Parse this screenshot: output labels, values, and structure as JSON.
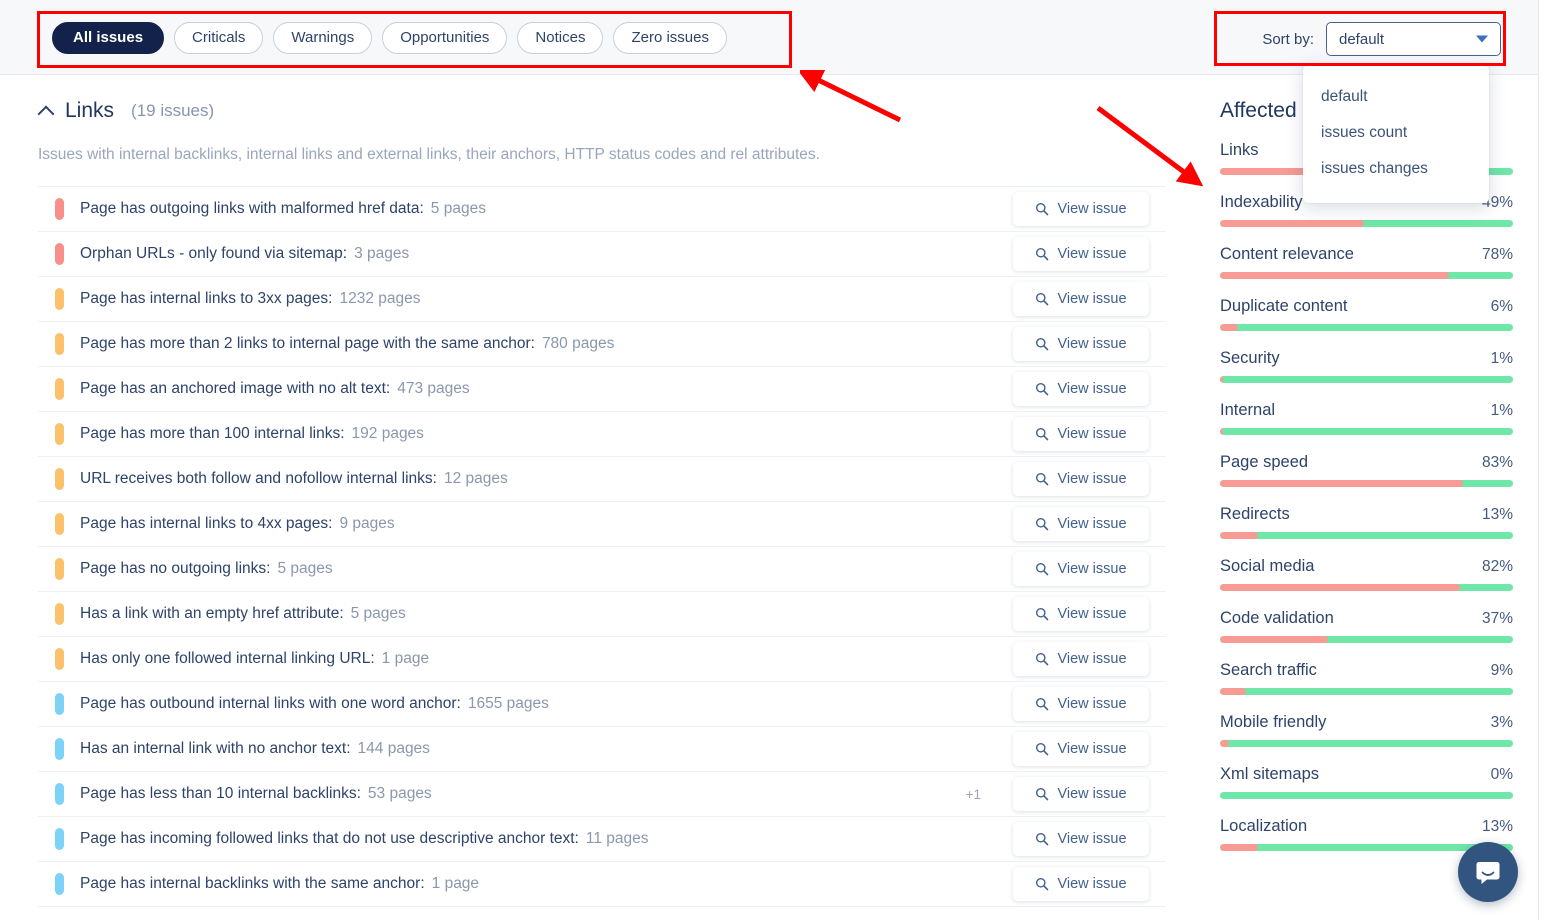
{
  "filters": {
    "tabs": [
      {
        "label": "All issues",
        "active": true
      },
      {
        "label": "Criticals",
        "active": false
      },
      {
        "label": "Warnings",
        "active": false
      },
      {
        "label": "Opportunities",
        "active": false
      },
      {
        "label": "Notices",
        "active": false
      },
      {
        "label": "Zero issues",
        "active": false
      }
    ]
  },
  "sort": {
    "label": "Sort by:",
    "selected": "default",
    "options": [
      "default",
      "issues count",
      "issues changes"
    ],
    "open": true
  },
  "section": {
    "title": "Links",
    "count": "(19 issues)",
    "description": "Issues with internal backlinks, internal links and external links, their anchors, HTTP status codes and rel attributes.",
    "view_issue_label": "View issue",
    "collapse_icon": "chevron-up-icon",
    "search_icon": "search-icon"
  },
  "issues": [
    {
      "severity": "critical",
      "title": "Page has outgoing links with malformed href data:",
      "count": "5 pages",
      "extra": ""
    },
    {
      "severity": "critical",
      "title": "Orphan URLs - only found via sitemap:",
      "count": "3 pages",
      "extra": ""
    },
    {
      "severity": "warning",
      "title": "Page has internal links to 3xx pages:",
      "count": "1232 pages",
      "extra": ""
    },
    {
      "severity": "warning",
      "title": "Page has more than 2 links to internal page with the same anchor:",
      "count": "780 pages",
      "extra": ""
    },
    {
      "severity": "warning",
      "title": "Page has an anchored image with no alt text:",
      "count": "473 pages",
      "extra": ""
    },
    {
      "severity": "warning",
      "title": "Page has more than 100 internal links:",
      "count": "192 pages",
      "extra": ""
    },
    {
      "severity": "warning",
      "title": "URL receives both follow and nofollow internal links:",
      "count": "12 pages",
      "extra": ""
    },
    {
      "severity": "warning",
      "title": "Page has internal links to 4xx pages:",
      "count": "9 pages",
      "extra": ""
    },
    {
      "severity": "warning",
      "title": "Page has no outgoing links:",
      "count": "5 pages",
      "extra": ""
    },
    {
      "severity": "warning",
      "title": "Has a link with an empty href attribute:",
      "count": "5 pages",
      "extra": ""
    },
    {
      "severity": "warning",
      "title": "Has only one followed internal linking URL:",
      "count": "1 page",
      "extra": ""
    },
    {
      "severity": "notice",
      "title": "Page has outbound internal links with one word anchor:",
      "count": "1655 pages",
      "extra": ""
    },
    {
      "severity": "notice",
      "title": "Has an internal link with no anchor text:",
      "count": "144 pages",
      "extra": ""
    },
    {
      "severity": "notice",
      "title": "Page has less than 10 internal backlinks:",
      "count": "53 pages",
      "extra": "+1"
    },
    {
      "severity": "notice",
      "title": "Page has incoming followed links that do not use descriptive anchor text:",
      "count": "11 pages",
      "extra": ""
    },
    {
      "severity": "notice",
      "title": "Page has internal backlinks with the same anchor:",
      "count": "1 page",
      "extra": ""
    }
  ],
  "sidebar": {
    "title": "Affected pages",
    "badge": "?",
    "categories": [
      {
        "name": "Links",
        "pct": "",
        "value": 42
      },
      {
        "name": "Indexability",
        "pct": "49%",
        "value": 49
      },
      {
        "name": "Content relevance",
        "pct": "78%",
        "value": 78
      },
      {
        "name": "Duplicate content",
        "pct": "6%",
        "value": 6
      },
      {
        "name": "Security",
        "pct": "1%",
        "value": 1
      },
      {
        "name": "Internal",
        "pct": "1%",
        "value": 1
      },
      {
        "name": "Page speed",
        "pct": "83%",
        "value": 83
      },
      {
        "name": "Redirects",
        "pct": "13%",
        "value": 13
      },
      {
        "name": "Social media",
        "pct": "82%",
        "value": 82
      },
      {
        "name": "Code validation",
        "pct": "37%",
        "value": 37
      },
      {
        "name": "Search traffic",
        "pct": "9%",
        "value": 9
      },
      {
        "name": "Mobile friendly",
        "pct": "3%",
        "value": 3
      },
      {
        "name": "Xml sitemaps",
        "pct": "0%",
        "value": 0
      },
      {
        "name": "Localization",
        "pct": "13%",
        "value": 13
      }
    ]
  },
  "chat": {
    "icon": "chat-bubble-icon"
  },
  "colors": {
    "critical": "#f98f8a",
    "warning": "#fbc26b",
    "notice": "#7dd3f7",
    "bar_red": "#f79b94",
    "bar_green": "#6ee7a8",
    "active_tab": "#12224a",
    "annotation": "#ff0000"
  }
}
